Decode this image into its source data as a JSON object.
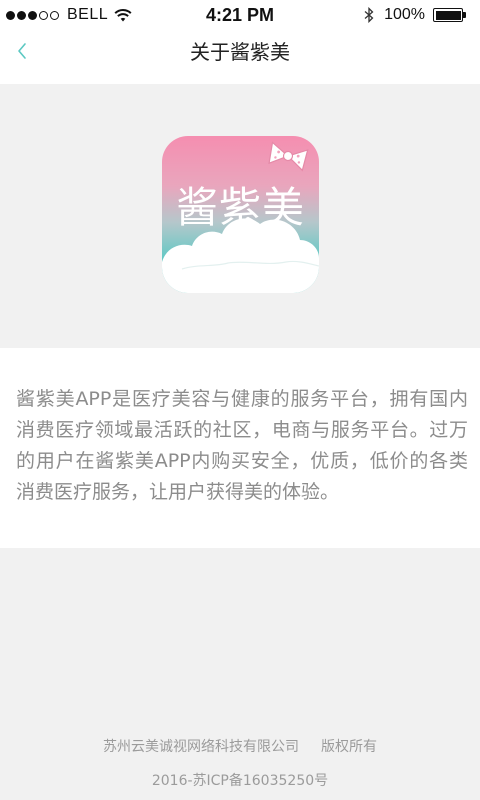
{
  "status_bar": {
    "carrier": "BELL",
    "time": "4:21 PM",
    "battery": "100%",
    "battery_level": 1.0,
    "signal_bars_filled": 3,
    "signal_bars_total": 5
  },
  "nav": {
    "title": "关于酱紫美",
    "back_icon": "chevron-left-icon",
    "accent_color": "#5bc8c2"
  },
  "app_icon": {
    "name": "酱紫美",
    "decoration": "bow-icon",
    "gradient_top": "#f58eb0",
    "gradient_bottom": "#4fc6c0"
  },
  "intro": {
    "text": "酱紫美APP是医疗美容与健康的服务平台，拥有国内消费医疗领域最活跃的社区，电商与服务平台。过万的用户在酱紫美APP内购买安全，优质，低价的各类消费医疗服务，让用户获得美的体验。"
  },
  "footer": {
    "company": "苏州云美诚视网络科技有限公司",
    "rights": "版权所有",
    "icp": "2016-苏ICP备16035250号"
  }
}
